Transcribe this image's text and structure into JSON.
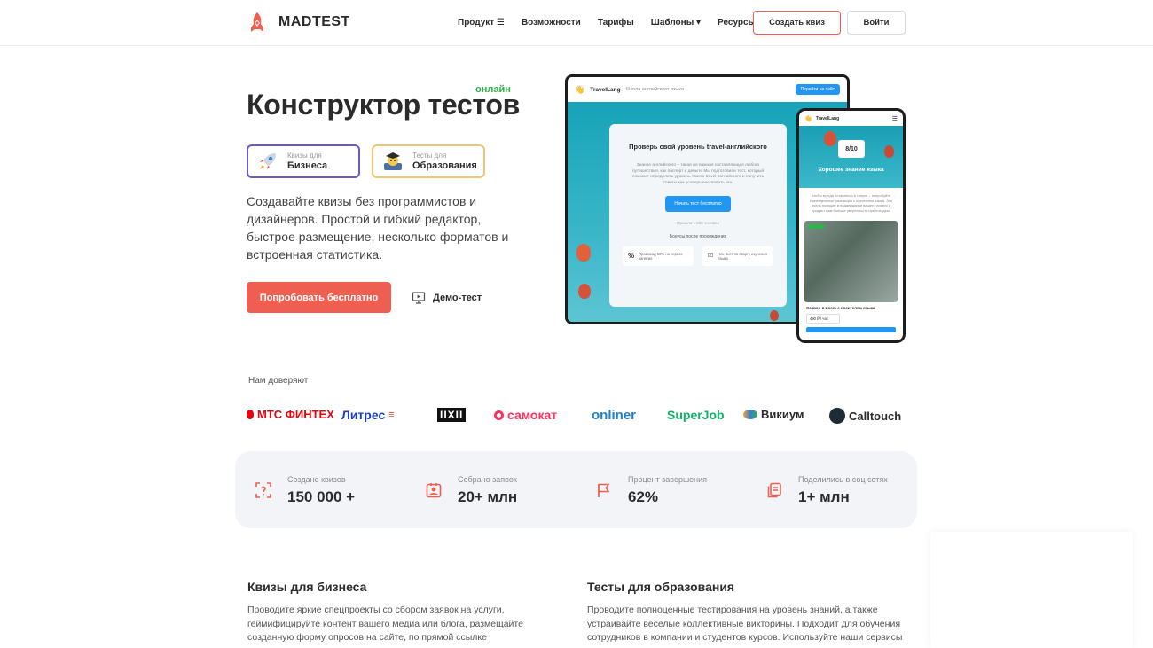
{
  "header": {
    "logo_text": "MADTEST",
    "nav": [
      {
        "label": "Продукт ☰"
      },
      {
        "label": "Возможности"
      },
      {
        "label": "Тарифы"
      },
      {
        "label": "Шаблоны ▾"
      },
      {
        "label": "Ресурсы ▾"
      }
    ],
    "create_quiz": "Создать квиз",
    "login": "Войти"
  },
  "hero": {
    "badge": "онлайн",
    "title": "Конструктор тестов",
    "tab_business_small": "Квизы для",
    "tab_business_big": "Бизнеса",
    "tab_education_small": "Тесты для",
    "tab_education_big": "Образования",
    "description": "Создавайте квизы без программистов и дизайнеров. Простой и гибкий редактор, быстрое размещение, несколько форматов и встроенная статистика.",
    "try_button": "Попробовать бесплатно",
    "demo_label": "Демо-тест"
  },
  "mockup": {
    "brand": "TravelLang",
    "subtitle": "Школа английского языка",
    "goto_site": "Перейти на сайт",
    "quiz_title": "Проверь свой уровень travel-английского",
    "quiz_text": "Знание английского – такая же важная составляющая любого путешествия, как паспорт и деньги. Мы подготовили тест, который поможет определить уровень твоего travel-английского и получить советы как усовершенствовать его.",
    "start_button": "Начать тест бесплатно",
    "passed": "Прошли 1 500 человек",
    "bonus_title": "Бонусы после прохождения",
    "bonus_1": "Промокод 50% на первое занятие",
    "bonus_2": "Чек-лист по старту изучения языка",
    "phone_score": "8/10",
    "phone_result": "Хорошее знание языка",
    "phone_text": "Чтобы всегда оставаться в тонусе – попробуйте еженедельные разговоры с носителем языка. Это очень поможет в поддержании вашего уровня и придаст вам больше уверенности при поездках",
    "phone_caption": "Созвон в Zoom с носителем языка",
    "phone_price": "490 ₽ / час"
  },
  "trust": {
    "label": "Нам доверяют",
    "partners": [
      "МТС ФИНТЕХ",
      "Литрес",
      "IIXII",
      "самокат",
      "onliner",
      "SuperJob",
      "Викиум",
      "Calltouch"
    ]
  },
  "stats": [
    {
      "label": "Создано квизов",
      "value": "150 000 +"
    },
    {
      "label": "Собрано заявок",
      "value": "20+ млн"
    },
    {
      "label": "Процент завершения",
      "value": "62%"
    },
    {
      "label": "Поделились в соц сетях",
      "value": "1+ млн"
    }
  ],
  "sections": {
    "business_title": "Квизы для бизнеса",
    "business_text": "Проводите яркие спецпроекты со сбором заявок на услуги, геймифицируйте контент вашего медиа или блога, размещайте созданную форму опросов на сайте, по прямой ссылке",
    "education_title": "Тесты для образования",
    "education_text": "Проводите полноценные тестирования на уровень знаний, а также устраивайте веселые коллективные викторины. Подходит для обучения сотрудников в компании и студентов курсов. Используйте наши сервисы"
  },
  "colors": {
    "accent": "#ee5f52",
    "online_green": "#2fb34a",
    "business_border": "#6a5acd",
    "education_border": "#f0c673",
    "stats_bg": "#f2f4f8"
  }
}
